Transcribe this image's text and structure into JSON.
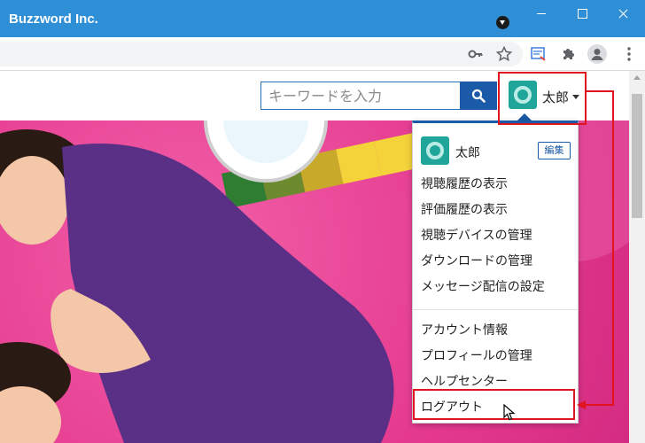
{
  "window": {
    "title": "Buzzword Inc.",
    "controls": [
      "minimize",
      "maximize",
      "close"
    ]
  },
  "toolbar": {
    "icons": [
      "key-icon",
      "star-icon",
      "extension-icon",
      "puzzle-icon",
      "account-icon",
      "menu-icon"
    ]
  },
  "search": {
    "placeholder": "キーワードを入力",
    "button_icon": "search-icon"
  },
  "account": {
    "user_name": "太郎",
    "avatar_color": "#1fa59a"
  },
  "dropdown": {
    "user_name": "太郎",
    "edit_label": "編集",
    "items_group1": [
      "視聴履歴の表示",
      "評価履歴の表示",
      "視聴デバイスの管理",
      "ダウンロードの管理",
      "メッセージ配信の設定"
    ],
    "items_group2": [
      "アカウント情報",
      "プロフィールの管理",
      "ヘルプセンター",
      "ログアウト"
    ]
  },
  "colors": {
    "titlebar": "#2f8fd6",
    "accent": "#1b5aa6",
    "annotation": "#e0141e",
    "hero": "#e53a8f"
  }
}
